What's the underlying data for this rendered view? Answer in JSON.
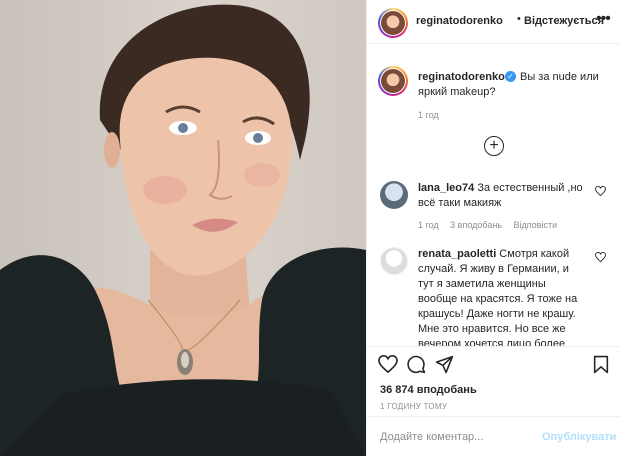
{
  "post": {
    "image_alt": "Selfie photo",
    "header": {
      "username": "reginatodorenko",
      "separator": "•",
      "follow_state": "Відстежується",
      "more_icon": "more-horizontal-icon"
    },
    "caption": {
      "username": "reginatodorenko",
      "verified_glyph": "✓",
      "text_line1": "Вы за nude или",
      "text_line2": "яркий makeup?",
      "time": "1 год"
    },
    "load_more_glyph": "+",
    "comments": [
      {
        "username": "lana_leo74",
        "text_line1_rest": " За естественный ,но",
        "text_line2": "всё таки макияж",
        "time": "1 год",
        "likes": "3 вподобань",
        "reply": "Відповісти"
      },
      {
        "username": "renata_paoletti",
        "lines": [
          " Смотря какой",
          "случай. Я живу в Германии, и",
          "тут я заметила женщины",
          "вообще на красятся. Я тоже на",
          "крашусь! Даже ногти не крашу.",
          "Мне это нравится. Но все же",
          "вечером хочется лицо более"
        ]
      }
    ],
    "actions": {
      "like_icon": "heart-icon",
      "comment_icon": "comment-icon",
      "share_icon": "share-icon",
      "save_icon": "bookmark-icon"
    },
    "likes_text": "36 874 вподобань",
    "posted_text": "1 ГОДИНУ ТОМУ",
    "add_comment": {
      "placeholder": "Додайте коментар...",
      "publish_label": "Опублікувати"
    },
    "colors": {
      "link_blue": "#3897f0",
      "publish_disabled": "#b2dffc",
      "muted": "#8e8e8e"
    }
  }
}
